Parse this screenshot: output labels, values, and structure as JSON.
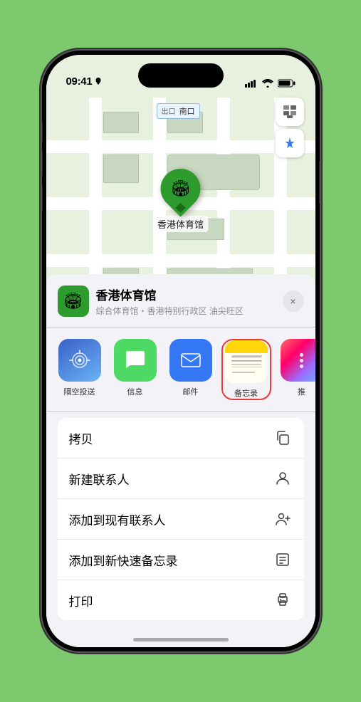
{
  "status_bar": {
    "time": "09:41",
    "location_arrow": true
  },
  "map": {
    "label_text": "南口",
    "label_prefix": "出口"
  },
  "map_controls": {
    "map_icon": "🗺",
    "location_icon": "➤"
  },
  "pin": {
    "label": "香港体育馆"
  },
  "venue": {
    "name": "香港体育馆",
    "subtitle": "综合体育馆・香港特别行政区 油尖旺区",
    "close_label": "×"
  },
  "share_items": [
    {
      "id": "airdrop",
      "label": "隔空投送",
      "icon_type": "airdrop"
    },
    {
      "id": "messages",
      "label": "信息",
      "icon_type": "messages"
    },
    {
      "id": "mail",
      "label": "邮件",
      "icon_type": "mail"
    },
    {
      "id": "notes",
      "label": "备忘录",
      "icon_type": "notes",
      "selected": true
    },
    {
      "id": "more",
      "label": "推",
      "icon_type": "more"
    }
  ],
  "action_items": [
    {
      "id": "copy",
      "text": "拷贝",
      "icon": "copy"
    },
    {
      "id": "new-contact",
      "text": "新建联系人",
      "icon": "person"
    },
    {
      "id": "add-contact",
      "text": "添加到现有联系人",
      "icon": "person-add"
    },
    {
      "id": "new-note",
      "text": "添加到新快速备忘录",
      "icon": "note"
    },
    {
      "id": "print",
      "text": "打印",
      "icon": "print"
    }
  ]
}
